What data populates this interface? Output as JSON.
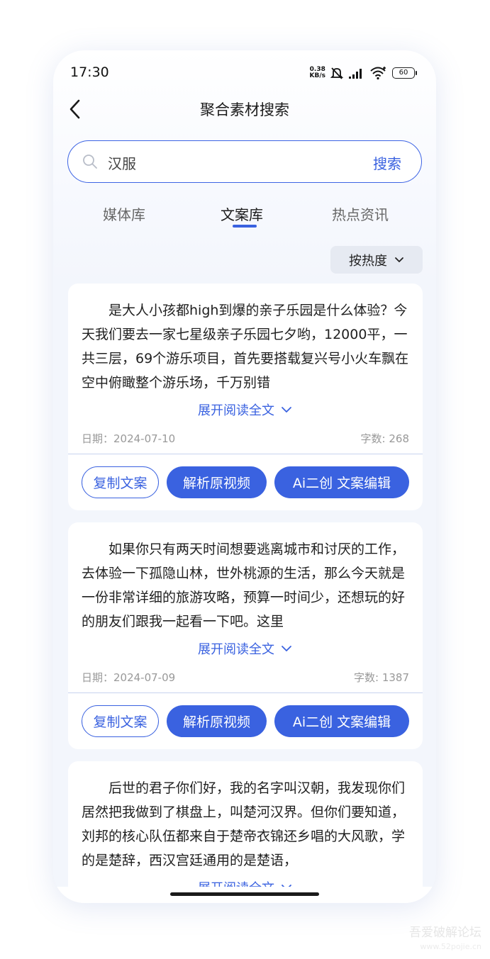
{
  "status_bar": {
    "time": "17:30",
    "net_speed_value": "0.38",
    "net_speed_unit": "KB/s",
    "battery": "60"
  },
  "header": {
    "title": "聚合素材搜索"
  },
  "search": {
    "query": "汉服",
    "button_label": "搜索"
  },
  "tabs": [
    {
      "label": "媒体库",
      "active": false
    },
    {
      "label": "文案库",
      "active": true
    },
    {
      "label": "热点资讯",
      "active": false
    }
  ],
  "sort": {
    "label": "按热度"
  },
  "cards": [
    {
      "text": "是大人小孩都high到爆的亲子乐园是什么体验？今天我们要去一家七星级亲子乐园七夕哟，12000平，一共三层，69个游乐项目，首先要搭载复兴号小火车飘在空中俯瞰整个游乐场，千万别错",
      "expand_label": "展开阅读全文",
      "date": "日期：2024-07-10",
      "count": "字数: 268",
      "copy_label": "复制文案",
      "parse_label": "解析原视频",
      "ai_label": "Ai二创 文案编辑"
    },
    {
      "text": "如果你只有两天时间想要逃离城市和讨厌的工作，去体验一下孤隐山林，世外桃源的生活，那么今天就是一份非常详细的旅游攻略，预算一时间少，还想玩的好的朋友们跟我一起看一下吧。这里",
      "expand_label": "展开阅读全文",
      "date": "日期：2024-07-09",
      "count": "字数: 1387",
      "copy_label": "复制文案",
      "parse_label": "解析原视频",
      "ai_label": "Ai二创 文案编辑"
    },
    {
      "text": "后世的君子你们好，我的名字叫汉朝，我发现你们居然把我做到了棋盘上，叫楚河汉界。但你们要知道，刘邦的核心队伍都来自于楚帝衣锦还乡唱的大风歌，学的是楚辞，西汉宫廷通用的是楚语，",
      "expand_label": "展开阅读全文"
    }
  ],
  "watermark": {
    "line1": "吾爱破解论坛",
    "line2": "www.52pojie.cn"
  },
  "colors": {
    "accent": "#3a62e0",
    "background": "#f3f6fc",
    "card": "#ffffff"
  },
  "icons": [
    "back-icon",
    "search-icon",
    "chevron-down-icon",
    "mute-bell-icon",
    "signal-icon",
    "wifi-icon",
    "battery-icon"
  ]
}
